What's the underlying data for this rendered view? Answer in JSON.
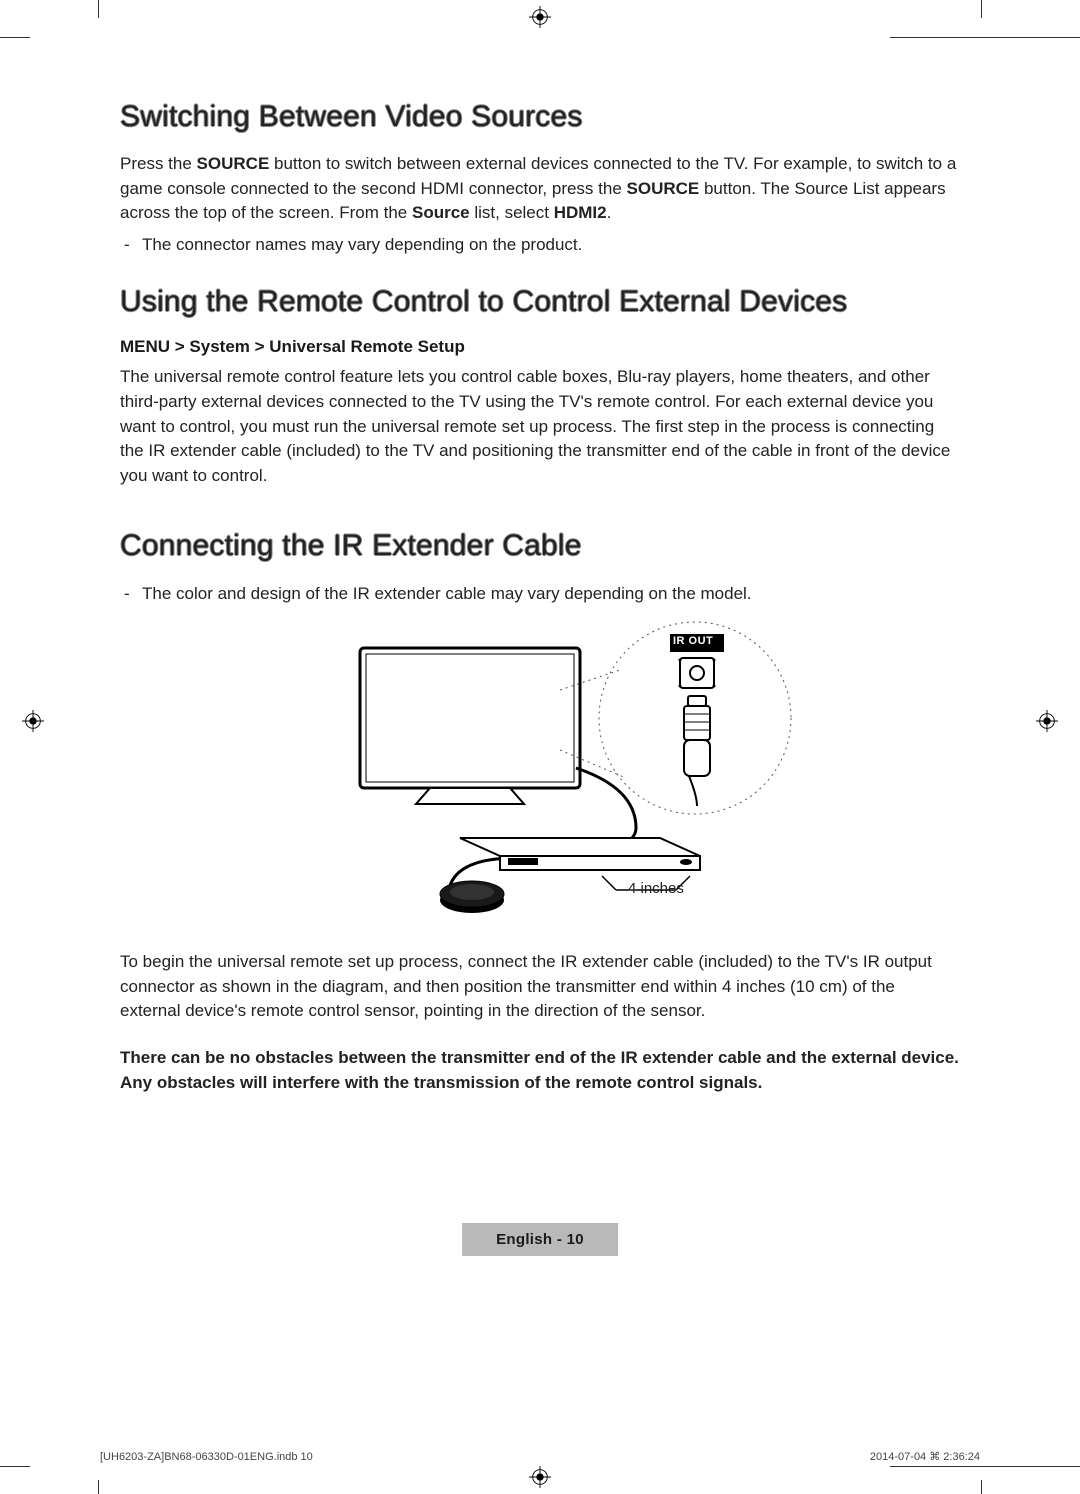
{
  "section1": {
    "heading": "Switching Between Video Sources",
    "para_parts": {
      "p1a": "Press the ",
      "p1b": "SOURCE",
      "p1c": " button to switch between external devices connected to the TV. For example, to switch to a game console connected to the second HDMI connector, press the ",
      "p1d": "SOURCE",
      "p1e": " button. The Source List appears across the top of the screen. From the ",
      "p1f": "Source",
      "p1g": " list, select ",
      "p1h": "HDMI2",
      "p1i": "."
    },
    "bullet1": "The connector names may vary depending on the product."
  },
  "section2": {
    "heading": "Using the Remote Control to Control External Devices",
    "menu_path": "MENU > System > Universal Remote Setup",
    "para": "The universal remote control feature lets you control cable boxes, Blu-ray players, home theaters, and other third-party external devices connected to the TV using the TV's remote control. For each external device you want to control, you must run the universal remote set up process. The first step in the process is connecting the IR extender cable (included) to the TV and positioning the transmitter end of the cable in front of the device you want to control."
  },
  "section3": {
    "heading": "Connecting the IR Extender Cable",
    "bullet1": "The color and design of the IR extender cable may vary depending on the model.",
    "diagram": {
      "port_label": "IR OUT",
      "distance_label": "4 inches"
    },
    "para2": "To begin the universal remote set up process, connect the IR extender cable (included) to the TV's IR output connector as shown in the diagram, and then position the transmitter end within 4 inches (10 cm) of the external device's remote control sensor, pointing in the direction of the sensor.",
    "para3_bold": "There can be no obstacles between the transmitter end of the IR extender cable and the external device. Any obstacles will interfere with the transmission of the remote control signals."
  },
  "footer": {
    "badge": "English - 10",
    "imprint_left": "[UH6203-ZA]BN68-06330D-01ENG.indb   10",
    "imprint_right": "2014-07-04   ⌘ 2:36:24"
  }
}
